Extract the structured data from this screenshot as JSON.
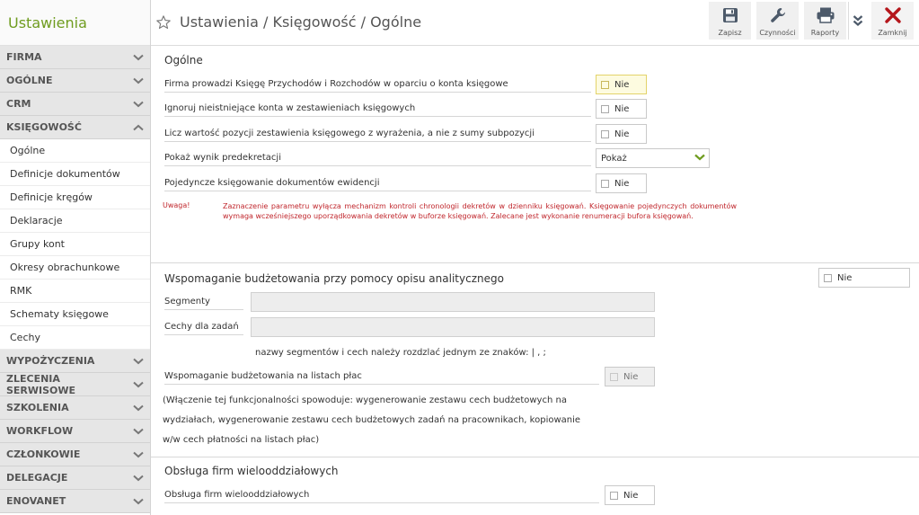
{
  "app": {
    "title": "Ustawienia"
  },
  "sidebar": {
    "sections_top": [
      {
        "label": "FIRMA"
      },
      {
        "label": "OGÓLNE"
      },
      {
        "label": "CRM"
      },
      {
        "label": "KSIĘGOWOŚĆ"
      }
    ],
    "items": [
      {
        "label": "Ogólne"
      },
      {
        "label": "Definicje dokumentów"
      },
      {
        "label": "Definicje kręgów"
      },
      {
        "label": "Deklaracje"
      },
      {
        "label": "Grupy kont"
      },
      {
        "label": "Okresy obrachunkowe"
      },
      {
        "label": "RMK"
      },
      {
        "label": "Schematy księgowe"
      },
      {
        "label": "Cechy"
      }
    ],
    "sections_bottom": [
      {
        "label": "WYPOŻYCZENIA"
      },
      {
        "label": "ZLECENIA SERWISOWE"
      },
      {
        "label": "SZKOLENIA"
      },
      {
        "label": "WORKFLOW"
      },
      {
        "label": "CZŁONKOWIE"
      },
      {
        "label": "DELEGACJE"
      },
      {
        "label": "ENOVANET"
      }
    ]
  },
  "header": {
    "breadcrumb": "Ustawienia / Księgowość / Ogólne",
    "toolbar": {
      "save": "Zapisz",
      "actions": "Czynności",
      "reports": "Raporty",
      "close": "Zamknij"
    }
  },
  "general": {
    "title": "Ogólne",
    "rows": [
      {
        "label": "Firma prowadzi Księgę Przychodów i Rozchodów w oparciu o konta księgowe",
        "value": "Nie"
      },
      {
        "label": "Ignoruj nieistniejące konta w zestawieniach księgowych",
        "value": "Nie"
      },
      {
        "label": "Licz wartość pozycji zestawienia księgowego z wyrażenia, a nie z sumy subpozycji",
        "value": "Nie"
      },
      {
        "label": "Pokaż wynik predekretacji",
        "value": "Pokaż"
      },
      {
        "label": "Pojedyncze księgowanie dokumentów ewidencji",
        "value": "Nie"
      }
    ],
    "warning_label": "Uwaga!",
    "warning_text": "Zaznaczenie parametru wyłącza mechanizm kontroli chronologii dekretów w dzienniku księgowań. Księgowanie pojedynczych dokumentów wymaga wcześniejszego uporządkowania dekretów w buforze księgowań. Zalecane jest wykonanie renumeracji bufora księgowań."
  },
  "budget": {
    "title": "Wspomaganie budżetowania przy pomocy opisu analitycznego",
    "value": "Nie",
    "segments_label": "Segmenty",
    "segments_value": "",
    "task_features_label": "Cechy dla zadań",
    "task_features_value": "",
    "separator_hint": "nazwy segmentów i cech należy rozdzlać jednym ze znaków: | , ;",
    "payroll_label": "Wspomaganie budżetowania na listach płac",
    "payroll_value": "Nie",
    "payroll_info_1": "(Włączenie tej funkcjonalności spowoduje: wygenerowanie zestawu cech budżetowych na",
    "payroll_info_2": "wydziałach, wygenerowanie zestawu cech budżetowych zadań na pracownikach, kopiowanie",
    "payroll_info_3": "w/w cech płatności na listach płac)"
  },
  "branches": {
    "title": "Obsługa firm wielooddziałowych",
    "label": "Obsługa firm wielooddziałowych",
    "value": "Nie"
  },
  "colors": {
    "accent": "#6f9c1f",
    "warning": "#c0262c",
    "close": "#b5161b",
    "icon": "#4d5a6a"
  }
}
